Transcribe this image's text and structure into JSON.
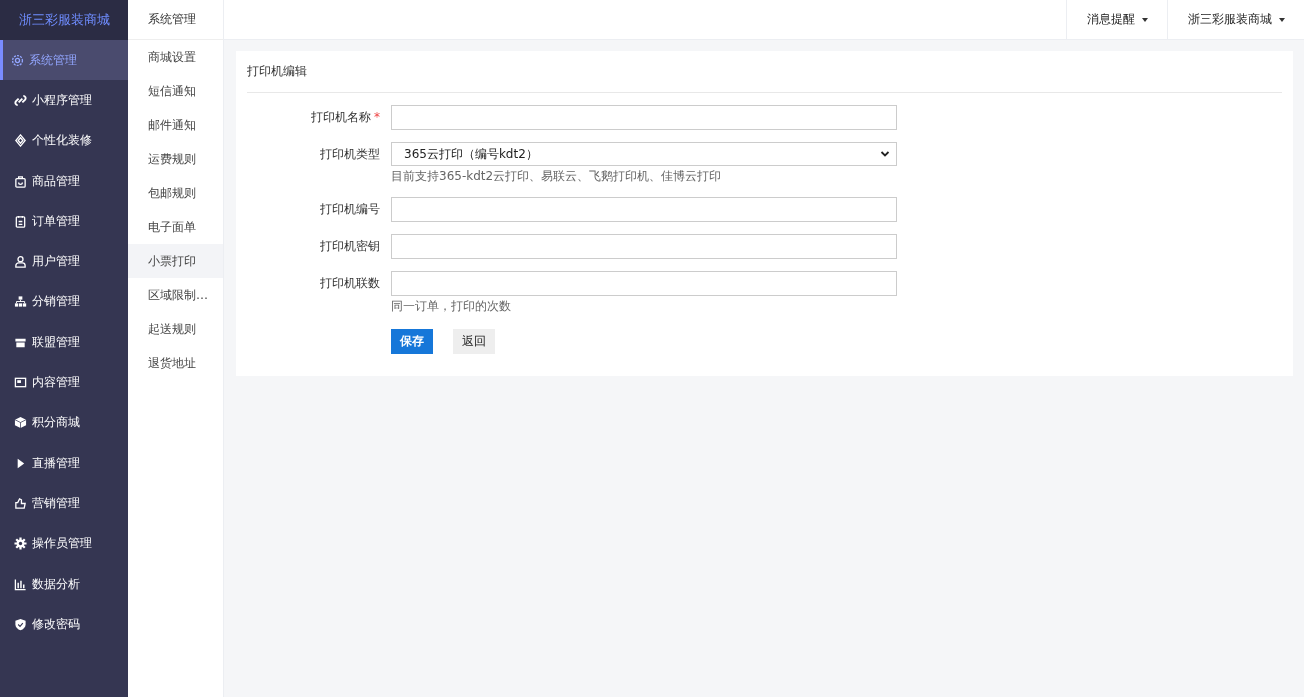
{
  "logo": "浙三彩服装商城",
  "sidebar": {
    "items": [
      {
        "label": "系统管理",
        "selected": true
      },
      {
        "label": "小程序管理",
        "selected": false
      },
      {
        "label": "个性化装修",
        "selected": false
      },
      {
        "label": "商品管理",
        "selected": false
      },
      {
        "label": "订单管理",
        "selected": false
      },
      {
        "label": "用户管理",
        "selected": false
      },
      {
        "label": "分销管理",
        "selected": false
      },
      {
        "label": "联盟管理",
        "selected": false
      },
      {
        "label": "内容管理",
        "selected": false
      },
      {
        "label": "积分商城",
        "selected": false
      },
      {
        "label": "直播管理",
        "selected": false
      },
      {
        "label": "营销管理",
        "selected": false
      },
      {
        "label": "操作员管理",
        "selected": false
      },
      {
        "label": "数据分析",
        "selected": false
      },
      {
        "label": "修改密码",
        "selected": false
      }
    ]
  },
  "subnav": {
    "title": "系统管理",
    "items": [
      {
        "label": "商城设置",
        "selected": false
      },
      {
        "label": "短信通知",
        "selected": false
      },
      {
        "label": "邮件通知",
        "selected": false
      },
      {
        "label": "运费规则",
        "selected": false
      },
      {
        "label": "包邮规则",
        "selected": false
      },
      {
        "label": "电子面单",
        "selected": false
      },
      {
        "label": "小票打印",
        "selected": true
      },
      {
        "label": "区域限制…",
        "selected": false
      },
      {
        "label": "起送规则",
        "selected": false
      },
      {
        "label": "退货地址",
        "selected": false
      }
    ]
  },
  "topbar": {
    "menus": [
      "消息提醒",
      "浙三彩服装商城"
    ]
  },
  "card": {
    "title": "打印机编辑",
    "fields": [
      {
        "kind": "input",
        "label": "打印机名称",
        "required_mark": "*"
      },
      {
        "kind": "select",
        "label": "打印机类型",
        "value": "365云打印（编号kdt2）",
        "help": "目前支持365-kdt2云打印、易联云、飞鹅打印机、佳博云打印"
      },
      {
        "kind": "input",
        "label": "打印机编号"
      },
      {
        "kind": "input",
        "label": "打印机密钥"
      },
      {
        "kind": "input",
        "label": "打印机联数",
        "help": "同一订单，打印的次数"
      }
    ],
    "buttons": [
      {
        "kind": "primary",
        "label": "保存"
      },
      {
        "kind": "default",
        "label": "返回"
      }
    ]
  }
}
